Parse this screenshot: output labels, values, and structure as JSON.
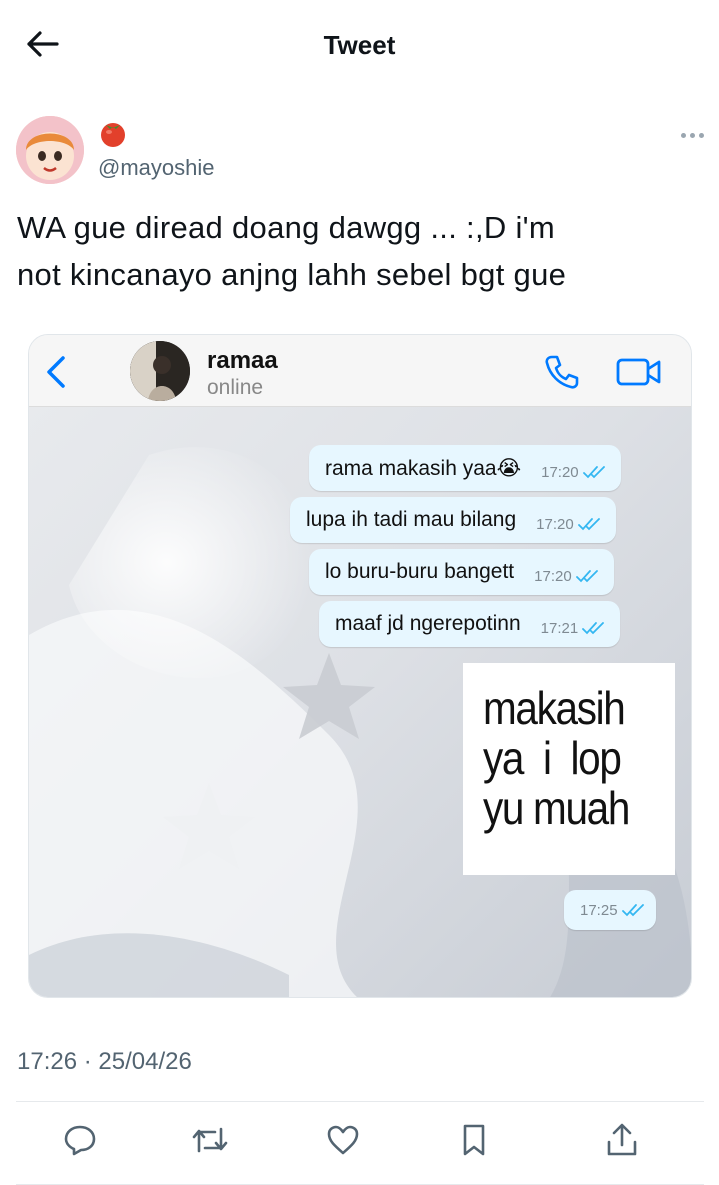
{
  "header": {
    "title": "Tweet"
  },
  "author": {
    "handle": "@mayoshie",
    "name_emoji": "tomato"
  },
  "tweet": {
    "text_line1": "WA gue diread doang dawgg ... :,D i'm",
    "text_line2": "not kincanayo anjng lahh sebel bgt gue",
    "timestamp": "17:26 · 25/04/26"
  },
  "chat": {
    "contact_name": "ramaa",
    "contact_status": "online",
    "messages": [
      {
        "text": "rama makasih yaa😭",
        "time": "17:20"
      },
      {
        "text": "lupa ih tadi mau bilang",
        "time": "17:20"
      },
      {
        "text": "lo buru-buru bangett",
        "time": "17:20"
      },
      {
        "text": "maaf jd ngerepotinn",
        "time": "17:21"
      }
    ],
    "sticker_text": "makasih\nya  i  lop\nyu muah",
    "sticker_time": "17:25",
    "accent_color": "#007aff",
    "tick_color": "#34b7f1"
  },
  "actions": [
    {
      "icon": "reply-icon"
    },
    {
      "icon": "retweet-icon"
    },
    {
      "icon": "like-icon"
    },
    {
      "icon": "bookmark-icon"
    },
    {
      "icon": "share-icon"
    }
  ]
}
